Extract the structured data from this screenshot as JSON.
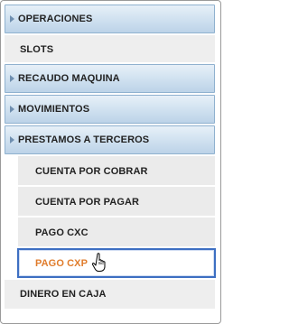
{
  "menu": {
    "operaciones": "OPERACIONES",
    "slots": "SLOTS",
    "recaudo": "RECAUDO MAQUINA",
    "movimientos": "MOVIMIENTOS",
    "prestamos": "PRESTAMOS A TERCEROS",
    "sub": {
      "cuenta_cobrar": "CUENTA POR COBRAR",
      "cuenta_pagar": "CUENTA POR PAGAR",
      "pago_cxc": "PAGO CXC",
      "pago_cxp": "PAGO CXP"
    },
    "dinero_caja": "DINERO EN CAJA"
  },
  "icons": {
    "section_arrow": "arrow-right-icon",
    "cursor": "hand-pointer-icon"
  },
  "colors": {
    "section_border": "#8fb1cf",
    "active_border": "#3d6fc2",
    "active_text": "#e07c2c"
  }
}
